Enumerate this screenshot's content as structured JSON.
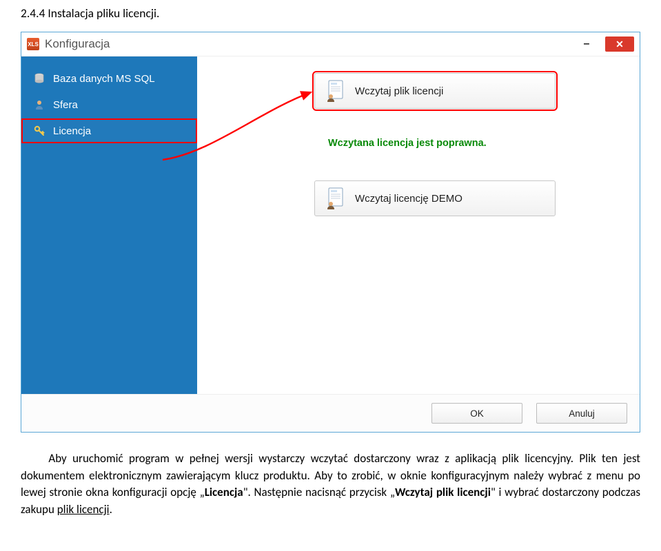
{
  "doc": {
    "heading": "2.4.4 Instalacja pliku licencji.",
    "para_prefix": "Aby uruchomić program w pełnej wersji wystarczy wczytać dostarczony wraz z aplikacją plik licencyjny. Plik ten jest dokumentem elektronicznym zawierającym klucz produktu. Aby to zrobić, w oknie konfiguracyjnym należy wybrać z menu po lewej stronie okna konfiguracji opcję „",
    "para_bold": "Licencja",
    "para_mid": "\". Następnie nacisnąć przycisk „",
    "para_bold2": "Wczytaj plik licencji",
    "para_mid2": "\" i wybrać dostarczony podczas zakupu ",
    "para_underline": "plik licencji",
    "para_end": "."
  },
  "window": {
    "title": "Konfiguracja",
    "sidebar": {
      "items": [
        {
          "label": "Baza danych MS SQL"
        },
        {
          "label": "Sfera"
        },
        {
          "label": "Licencja"
        }
      ]
    },
    "buttons": {
      "load_license": "Wczytaj plik licencji",
      "load_demo": "Wczytaj licencję DEMO",
      "ok": "OK",
      "cancel": "Anuluj"
    },
    "status": "Wczytana licencja jest poprawna."
  }
}
